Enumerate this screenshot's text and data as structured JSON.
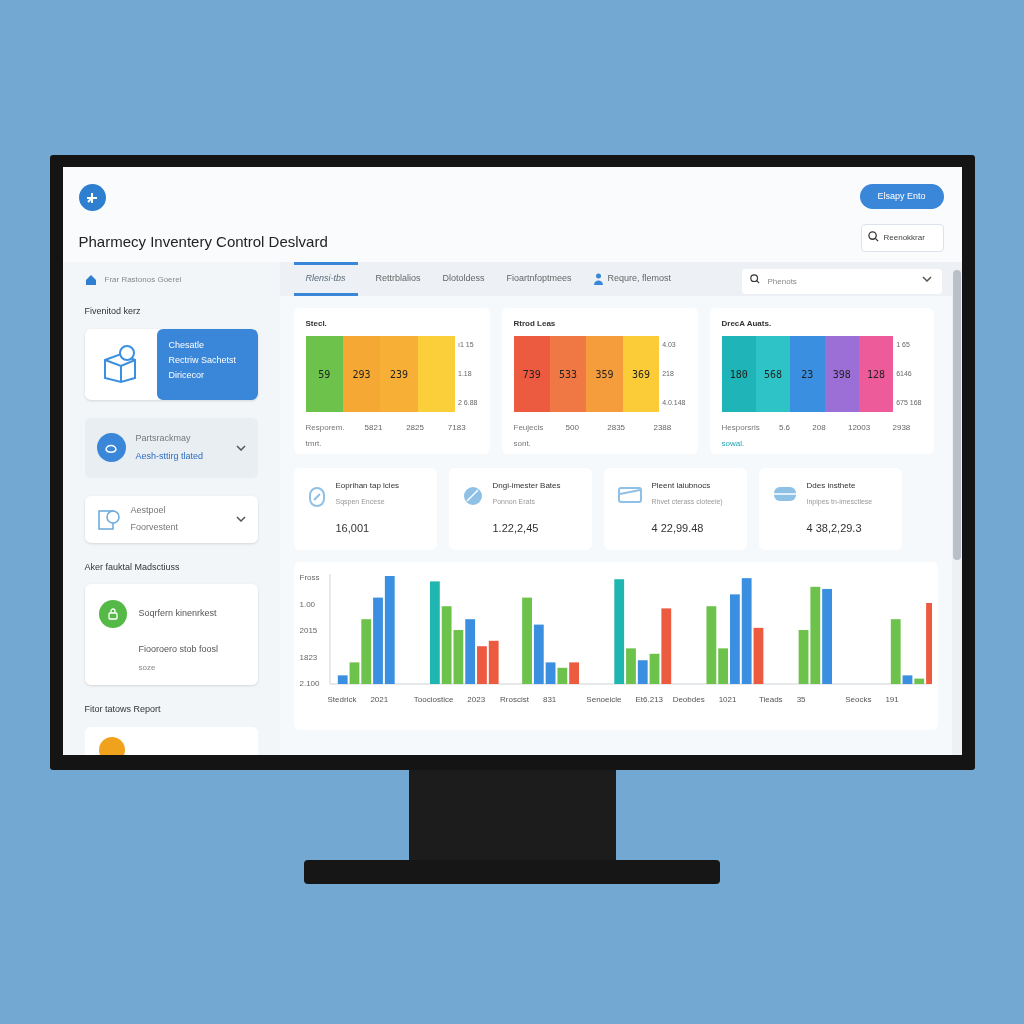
{
  "header": {
    "title": "Pharmecy Inventery Control Deslvard",
    "button": "Elsapy Ento",
    "search": {
      "placeholder": "Reenokkrar"
    }
  },
  "sidebar": {
    "top_link": "Frar Rastonos Goerel",
    "sections": [
      {
        "title": "Fivenitod kerz",
        "cards": [
          {
            "kind": "feature",
            "lines": [
              "Chesatle",
              "Rectriw Sachetst",
              "Diricecor"
            ]
          },
          {
            "kind": "expandable",
            "highlighted": true,
            "title": "Partsrackmay",
            "subtitle": "Aesh-sttirg tlated",
            "expanded": false
          },
          {
            "kind": "expandable",
            "highlighted": false,
            "title": "Aestpoel",
            "subtitle": "Foorvestent",
            "expanded": false
          }
        ]
      },
      {
        "title": "Aker fauktal Madsctiuss",
        "cards": [
          {
            "kind": "note",
            "title": "Soqrfern kinenrkest",
            "lines": [
              "Fiooroero stob foosl",
              "soze"
            ]
          }
        ]
      },
      {
        "title": "Fitor tatows Report",
        "cards": [
          {
            "kind": "cut"
          }
        ]
      }
    ]
  },
  "tabs": [
    {
      "label": "Rlensi-tbs",
      "selected": true
    },
    {
      "label": "Rettrblalios",
      "selected": false
    },
    {
      "label": "Dlotoldess",
      "selected": false
    },
    {
      "label": "Fioartnfoptmees",
      "selected": false
    },
    {
      "label": "Requre, flemost",
      "selected": false,
      "icon": true
    }
  ],
  "filter": {
    "placeholder": "Phenots"
  },
  "stack_cards": [
    {
      "title": "Stecl.",
      "segments": [
        {
          "label": "59",
          "color": "#6cc24a"
        },
        {
          "label": "293",
          "color": "#f5a934"
        },
        {
          "label": "239",
          "color": "#f7b035"
        },
        {
          "color": "#fbcf3a"
        }
      ],
      "right_labels": [
        "ı1 15",
        "1.18",
        "2 6.88"
      ],
      "caption": [
        "Resporem.",
        "tmrt."
      ],
      "bottom_labels": [
        "5821",
        "2825",
        "7183"
      ]
    },
    {
      "title": "Rtrod Leas",
      "segments": [
        {
          "label": "739",
          "color": "#ec5a40"
        },
        {
          "label": "533",
          "color": "#f07845"
        },
        {
          "label": "359",
          "color": "#f59c3c"
        },
        {
          "label": "369",
          "color": "#fbcc38"
        }
      ],
      "right_labels": [
        "4.03",
        "218",
        "4.0.148"
      ],
      "caption": [
        "Feujecis",
        "sont."
      ],
      "bottom_labels": [
        "500",
        "2835",
        "2388"
      ]
    },
    {
      "title": "DrecA Auats.",
      "segments": [
        {
          "label": "180",
          "color": "#1fb5b8"
        },
        {
          "label": "568",
          "color": "#2ec4c7"
        },
        {
          "label": "23",
          "color": "#3a8fe0"
        },
        {
          "label": "398",
          "color": "#9b6fd6"
        },
        {
          "label": "128",
          "color": "#ee5b9a"
        }
      ],
      "right_labels": [
        "1 65",
        "6146",
        "675 168"
      ],
      "caption": [
        "Hesporsris",
        "sowal."
      ],
      "bottom_labels": [
        "5.6",
        "208",
        "12003",
        "2938"
      ]
    }
  ],
  "metrics": [
    {
      "kind": "capsule",
      "title": "Eoprihan tap lcles",
      "subtitle": "Sqspen Encese",
      "value": "16,001"
    },
    {
      "kind": "pill",
      "title": "Dngi-imester Bates",
      "subtitle": "Ponnon Erats",
      "value": "1.22,2,45"
    },
    {
      "kind": "box",
      "title": "Pleent laiubnocs",
      "subtitle": "Rhvet cterass cioteele)",
      "value": "4 22,99.48"
    },
    {
      "kind": "tablet",
      "title": "Ddes insthete",
      "subtitle": "Inpipes tn-imesctiese",
      "value": "4 38,2,29.3"
    }
  ],
  "bar_chart": {
    "y_labels": [
      "Fross",
      "1.00",
      "2015",
      "1823",
      "2.100"
    ],
    "groups": [
      {
        "name": "Stedrick",
        "year": "2021"
      },
      {
        "name": "Toociostice",
        "year": "2023"
      },
      {
        "name": "Rroscist",
        "year": "831"
      },
      {
        "name": "Senoeicle",
        "year": "Et6.213"
      },
      {
        "name": "Deobdes",
        "year": "1021"
      },
      {
        "name": "Tieads",
        "year": "35"
      },
      {
        "name": "Seocks",
        "year": "191"
      }
    ]
  }
}
